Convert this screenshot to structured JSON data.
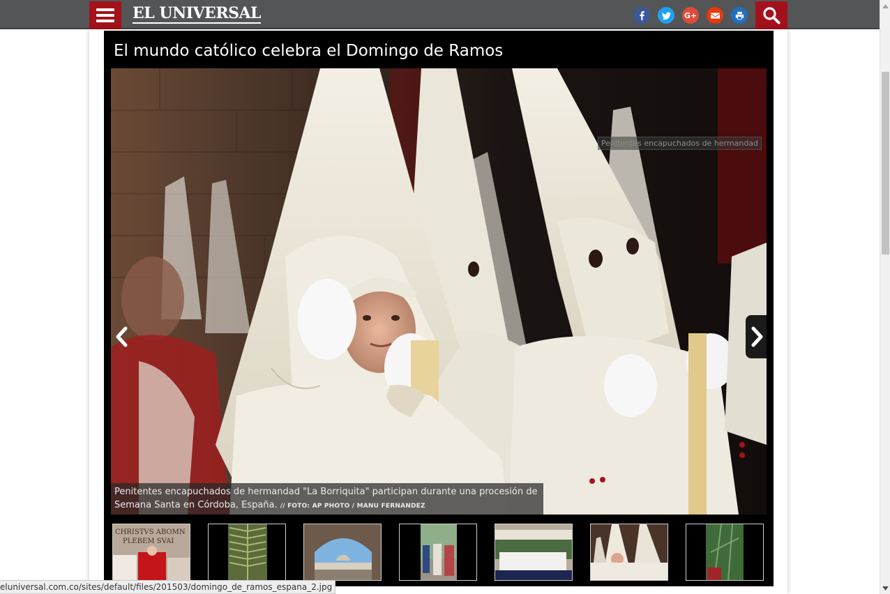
{
  "header": {
    "menu_icon": "hamburger-icon",
    "logo_text": "EL UNIVERSAL",
    "socials": [
      {
        "name": "facebook",
        "glyph": "f",
        "color": "#3b5998"
      },
      {
        "name": "twitter",
        "glyph": "t",
        "color": "#1da1f2"
      },
      {
        "name": "google-plus",
        "glyph": "G+",
        "color": "#dd4b39"
      },
      {
        "name": "email",
        "glyph": "✉",
        "color": "#e8380d"
      },
      {
        "name": "print",
        "glyph": "⎙",
        "color": "#1f6fc1"
      }
    ],
    "search_icon": "search-icon",
    "accent_color": "#a3111b"
  },
  "gallery": {
    "title": "El mundo católico celebra el Domingo de Ramos",
    "tooltip": "Penitentes encapuchados de hermandad",
    "caption": "Penitentes encapuchados de hermandad \"La Borriquita\" participan durante una procesión de Semana Santa en Córdoba, España.",
    "credit": "// FOTO: AP PHOTO / MANU FERNANDEZ",
    "thumbnails": [
      {
        "alt": "Christus abominabili plebem"
      },
      {
        "alt": "Palm leaf"
      },
      {
        "alt": "Saint Peter's Square"
      },
      {
        "alt": "Procession in street"
      },
      {
        "alt": "Float with flowers"
      },
      {
        "alt": "Hooded penitents"
      },
      {
        "alt": "Palm procession"
      }
    ],
    "thumbnail_text": "CHRISTVS ABOMN PLEBEM SVAI"
  },
  "statusbar": {
    "url": "eluniversal.com.co/sites/default/files/201503/domingo_de_ramos_espana_2.jpg"
  }
}
